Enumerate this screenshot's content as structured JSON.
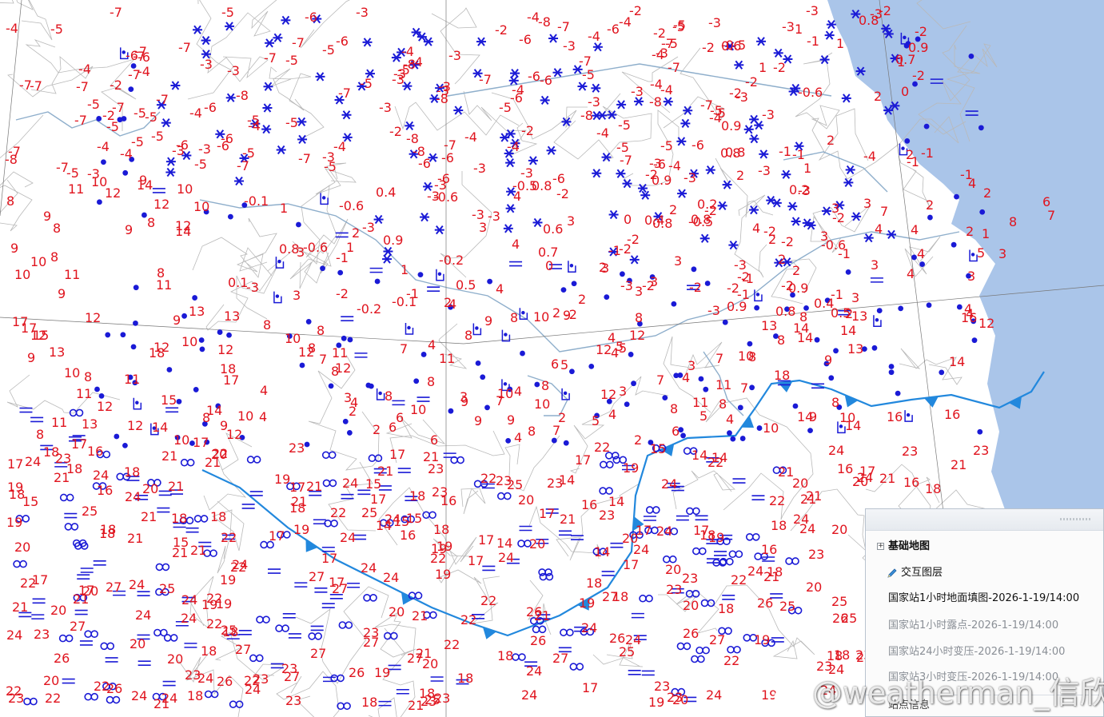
{
  "map": {
    "colors": {
      "land": "#ffffff",
      "sea": "#aac5e9",
      "border": "#b9b9b9",
      "river": "#8eaecb",
      "temperature": "#e0141e",
      "weather": "#1a1ad6",
      "front": "#2288dd"
    },
    "temperatures": [
      "-6",
      "-4",
      "-5",
      "-7",
      "-10",
      "-11",
      "-9",
      "-8",
      "-3",
      "-2",
      "-1",
      "-0.3",
      "-0.6",
      "0.8",
      "3",
      "4",
      "6",
      "8",
      "9",
      "10",
      "11",
      "12",
      "13",
      "15",
      "16",
      "17",
      "18",
      "19",
      "20",
      "21",
      "22",
      "23",
      "24",
      "25",
      "26",
      "27",
      "0.9",
      "-0.5",
      "0.5",
      "5",
      "7",
      "1",
      "2",
      "14",
      "0.7",
      "-0.2",
      "0.1",
      "0.2",
      "0.6",
      "-0.1",
      "0.4",
      "0"
    ],
    "weather_symbols": [
      "snow-star",
      "rain-dot",
      "haze-infinity",
      "fog-lines",
      "shower-bracket"
    ],
    "front_type": "cold-front"
  },
  "layers": {
    "base_map": "基础地图",
    "interactive": "交互图层",
    "items": [
      "国家站1小时地面填图-2026-1-19/14:00",
      "国家站1小时露点-2026-1-19/14:00",
      "国家站24小时变压-2026-1-19/14:00",
      "国家站3小时变压-2026-1-19/14:00"
    ],
    "station_info": "站点信息"
  },
  "watermark": "@weatherman_信欣"
}
